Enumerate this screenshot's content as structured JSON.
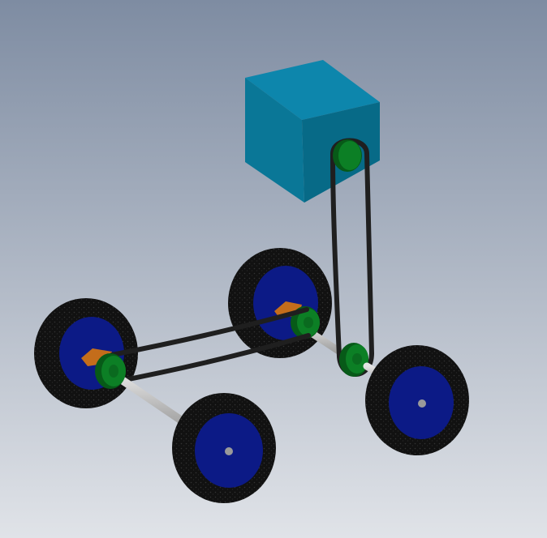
{
  "scene": {
    "background": {
      "top_color": "#7e8ca2",
      "bottom_color": "#e0e3e8"
    },
    "parts": {
      "motor_block": {
        "front_color": "#0a7797",
        "top_color": "#0d86ac",
        "side_color": "#076a87"
      },
      "wheel": {
        "tire_color": "#111111",
        "hub_color": "#0c1a86",
        "axle_cap_color": "#9a9a9a"
      },
      "pulley": {
        "color": "#0c7f25",
        "dark_color": "#075a18"
      },
      "belt": {
        "color": "#1f1f1f"
      },
      "axle": {
        "color": "#b8b8b8"
      },
      "bracket": {
        "color": "#c46d1b"
      }
    }
  }
}
